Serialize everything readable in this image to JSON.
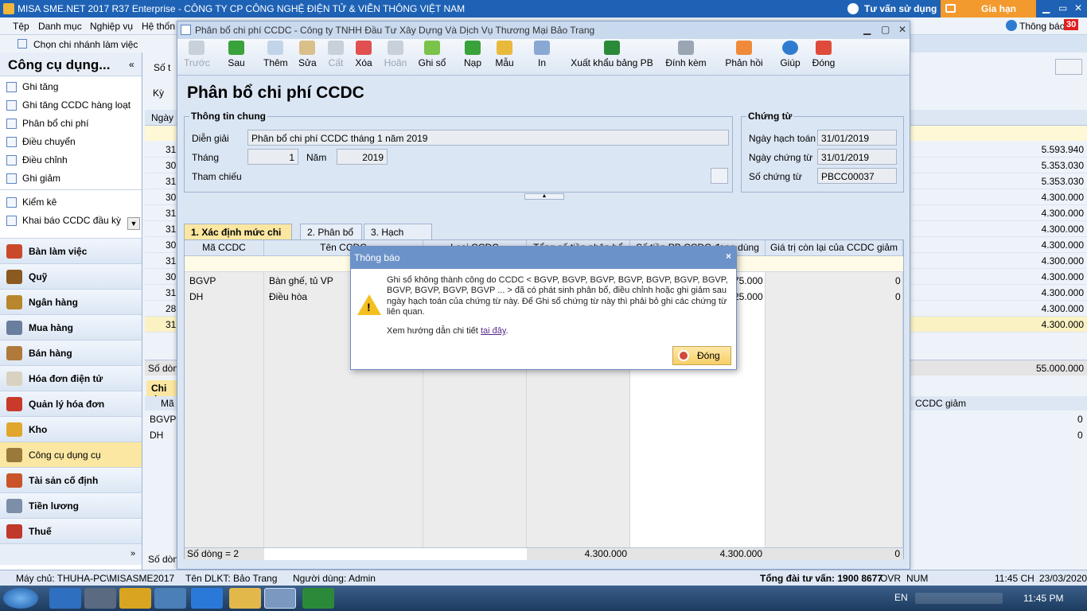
{
  "app": {
    "title": "MISA SME.NET 2017 R37 Enterprise - CÔNG TY CP CÔNG NGHỆ ĐIỆN TỬ & VIỄN THÔNG VIỆT NAM",
    "tu_van": "Tư vấn sử dụng",
    "gia_han": "Gia hạn",
    "thong_bao": "Thông báo",
    "thong_bao_count": "30"
  },
  "menu": [
    "Tệp",
    "Danh mục",
    "Nghiệp vụ",
    "Hệ thốn"
  ],
  "sub": {
    "chon_chi_nhanh": "Chọn chi nhánh làm việc",
    "tim": "Tìm"
  },
  "left": {
    "header": "Công cụ dụng...",
    "items": [
      "Ghi tăng",
      "Ghi tăng CCDC hàng loạt",
      "Phân bổ chi phí",
      "Điều chuyển",
      "Điều chỉnh",
      "Ghi giảm"
    ],
    "items2": [
      "Kiểm kê",
      "Khai báo CCDC đầu kỳ"
    ],
    "modules": [
      "Bàn làm việc",
      "Quỹ",
      "Ngân hàng",
      "Mua hàng",
      "Bán hàng",
      "Hóa đơn điện tử",
      "Quản lý hóa đơn",
      "Kho",
      "Công cụ dụng cụ",
      "Tài sản cố định",
      "Tiền lương",
      "Thuế"
    ]
  },
  "bg": {
    "so_label": "Số t",
    "ky_label": "Kỳ",
    "ngay_head": "Ngày",
    "rows": [
      {
        "d": "31",
        "v": "5.593.940"
      },
      {
        "d": "30",
        "v": "5.353.030"
      },
      {
        "d": "31",
        "v": "5.353.030"
      },
      {
        "d": "30",
        "v": "4.300.000"
      },
      {
        "d": "31",
        "v": "4.300.000"
      },
      {
        "d": "31",
        "v": "4.300.000"
      },
      {
        "d": "30",
        "v": "4.300.000"
      },
      {
        "d": "31",
        "v": "4.300.000"
      },
      {
        "d": "30",
        "v": "4.300.000"
      },
      {
        "d": "31",
        "v": "4.300.000"
      },
      {
        "d": "28",
        "v": "4.300.000"
      },
      {
        "d": "31",
        "v": "4.300.000"
      }
    ],
    "so_dong": "Số dòng",
    "total": "55.000.000",
    "chi_tiet": "Chi ti",
    "ma_head": "Mã",
    "ccdc_giam": "CCDC giảm",
    "d_rows": [
      {
        "a": "BGVP",
        "v": "0"
      },
      {
        "a": "DH",
        "v": "0"
      }
    ],
    "so_dong2": "Số dòn"
  },
  "dialog": {
    "title": "Phân bổ chi phí CCDC - Công ty TNHH Đầu Tư Xây Dựng Và Dịch Vụ Thương Mại Bảo Trang",
    "toolbar": [
      "Trước",
      "Sau",
      "Thêm",
      "Sửa",
      "Cất",
      "Xóa",
      "Hoãn",
      "Ghi sổ",
      "Nạp",
      "Mẫu",
      "In",
      "Xuất khẩu bảng PB",
      "Đính kèm",
      "Phản hồi",
      "Giúp",
      "Đóng"
    ],
    "heading": "Phân bổ chi phí CCDC",
    "thong_tin_chung": "Thông tin chung",
    "dien_giai_label": "Diễn giải",
    "dien_giai": "Phân bổ chi phí CCDC tháng 1 năm 2019",
    "thang_label": "Tháng",
    "thang": "1",
    "nam_label": "Năm",
    "nam": "2019",
    "tham_chieu": "Tham chiếu",
    "chung_tu": "Chứng từ",
    "ngay_hach_toan_label": "Ngày hạch toán",
    "ngay_hach_toan": "31/01/2019",
    "ngay_chung_tu_label": "Ngày chứng từ",
    "ngay_chung_tu": "31/01/2019",
    "so_chung_tu_label": "Số chứng từ",
    "so_chung_tu": "PBCC00037",
    "tabs": [
      "1. Xác định mức chi phí",
      "2. Phân bổ",
      "3. Hạch toán"
    ],
    "columns": [
      "Mã CCDC",
      "Tên CCDC",
      "Loại CCDC",
      "Tổng số tiền phân bổ",
      "Số tiền PB CCDC đang dùng",
      "Giá trị còn lại của CCDC giảm"
    ],
    "rows": [
      {
        "ma": "BGVP",
        "ten": "Bàn ghế, tủ VP",
        "pb": "75.000",
        "gt": "0"
      },
      {
        "ma": "DH",
        "ten": "Điều hòa",
        "pb": "25.000",
        "gt": "0"
      }
    ],
    "footer": {
      "so_dong": "Số dòng = 2",
      "tong": "4.300.000",
      "pb": "4.300.000",
      "gt": "0"
    }
  },
  "message": {
    "title": "Thông báo",
    "text": "Ghi sổ không thành công do CCDC < BGVP, BGVP, BGVP, BGVP, BGVP, BGVP, BGVP, BGVP, BGVP, BGVP, BGVP ... > đã có phát sinh phân bổ, điều chỉnh hoặc ghi giảm sau ngày hạch toán của chứng từ này. Để Ghi sổ chứng từ này thì phải bỏ ghi các chứng từ liên quan.",
    "link_prefix": "Xem hướng dẫn chi tiết",
    "link": "tại đây",
    "link_suffix": ".",
    "button": "Đóng"
  },
  "status": {
    "may_chu": "Máy chủ: THUHA-PC\\MISASME2017",
    "ten_dlkt": "Tên DLKT: Bảo Trang",
    "nguoi_dung": "Người dùng: Admin",
    "tong_dai": "Tổng đài tư vấn: 1900 8677",
    "ovr": "OVR",
    "num": "NUM",
    "time": "11:45 CH",
    "date": "23/03/2020"
  },
  "taskbar": {
    "lang": "EN",
    "clock": "11:45 PM"
  }
}
